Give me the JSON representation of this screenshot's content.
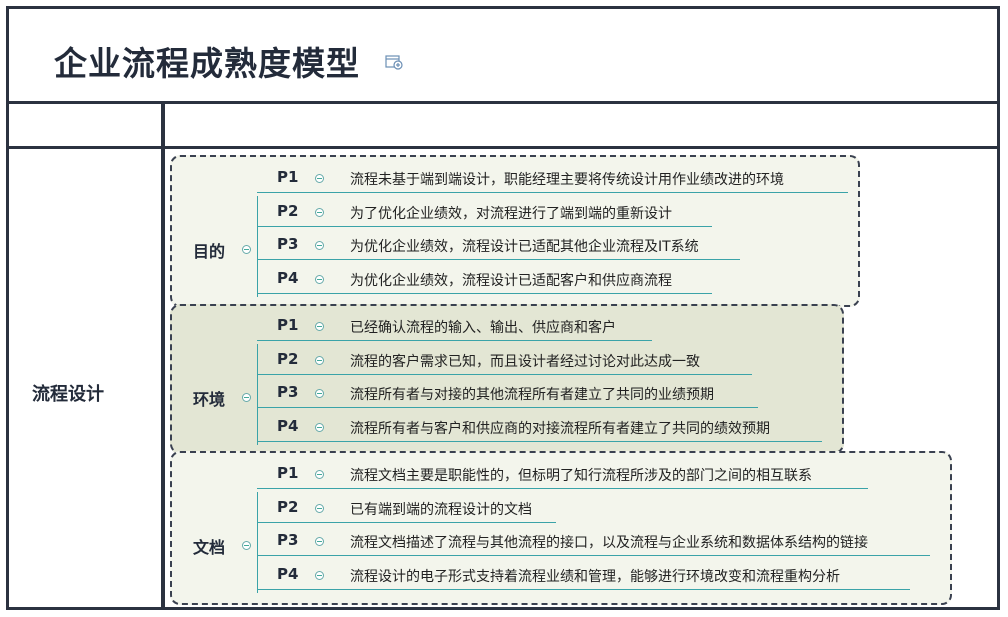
{
  "title": "企业流程成熟度模型",
  "row_label": "流程设计",
  "groups": [
    {
      "name": "目的",
      "items": [
        {
          "code": "P1",
          "text": "流程未基于端到端设计，职能经理主要将传统设计用作业绩改进的环境"
        },
        {
          "code": "P2",
          "text": "为了优化企业绩效，对流程进行了端到端的重新设计"
        },
        {
          "code": "P3",
          "text": "为优化企业绩效，流程设计已适配其他企业流程及IT系统"
        },
        {
          "code": "P4",
          "text": "为优化企业绩效，流程设计已适配客户和供应商流程"
        }
      ]
    },
    {
      "name": "环境",
      "items": [
        {
          "code": "P1",
          "text": "已经确认流程的输入、输出、供应商和客户"
        },
        {
          "code": "P2",
          "text": "流程的客户需求已知，而且设计者经过讨论对此达成一致"
        },
        {
          "code": "P3",
          "text": "流程所有者与对接的其他流程所有者建立了共同的业绩预期"
        },
        {
          "code": "P4",
          "text": "流程所有者与客户和供应商的对接流程所有者建立了共同的绩效预期"
        }
      ]
    },
    {
      "name": "文档",
      "items": [
        {
          "code": "P1",
          "text": "流程文档主要是职能性的，但标明了知行流程所涉及的部门之间的相互联系"
        },
        {
          "code": "P2",
          "text": "已有端到端的流程设计的文档"
        },
        {
          "code": "P3",
          "text": "流程文档描述了流程与其他流程的接口，以及流程与企业系统和数据体系结构的链接"
        },
        {
          "code": "P4",
          "text": "流程设计的电子形式支持着流程业绩和管理，能够进行环境改变和流程重构分析"
        }
      ]
    }
  ]
}
